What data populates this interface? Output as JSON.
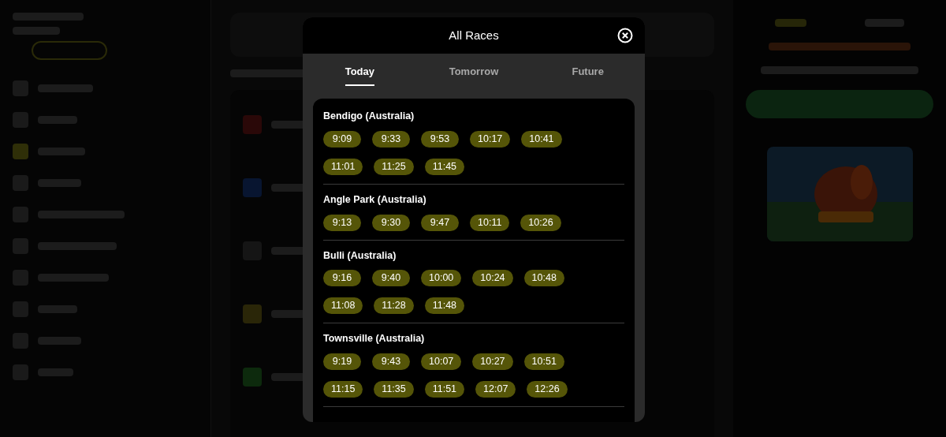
{
  "modal": {
    "title": "All Races"
  },
  "tabs": [
    {
      "label": "Today",
      "selected": true
    },
    {
      "label": "Tomorrow",
      "selected": false
    },
    {
      "label": "Future",
      "selected": false
    }
  ],
  "meetings": [
    {
      "name": "Bendigo (Australia)",
      "times": [
        "9:09",
        "9:33",
        "9:53",
        "10:17",
        "10:41",
        "11:01",
        "11:25",
        "11:45"
      ]
    },
    {
      "name": "Angle Park (Australia)",
      "times": [
        "9:13",
        "9:30",
        "9:47",
        "10:11",
        "10:26"
      ]
    },
    {
      "name": "Bulli (Australia)",
      "times": [
        "9:16",
        "9:40",
        "10:00",
        "10:24",
        "10:48",
        "11:08",
        "11:28",
        "11:48"
      ]
    },
    {
      "name": "Townsville (Australia)",
      "times": [
        "9:19",
        "9:43",
        "10:07",
        "10:27",
        "10:51",
        "11:15",
        "11:35",
        "11:51",
        "12:07",
        "12:26"
      ]
    }
  ]
}
